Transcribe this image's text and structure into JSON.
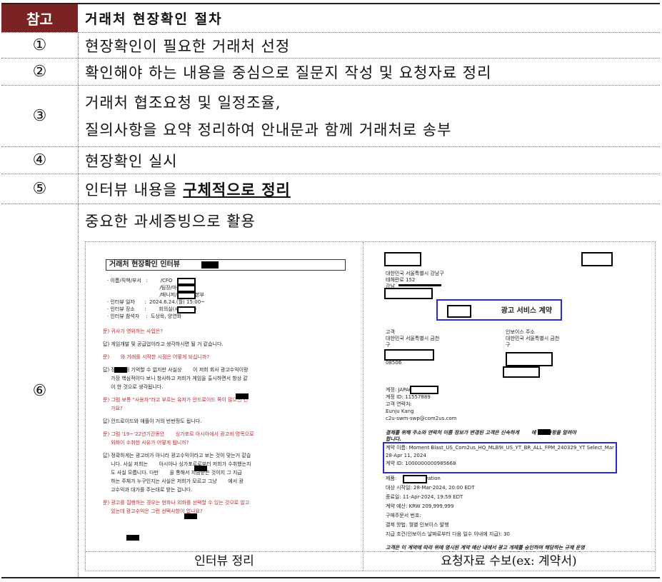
{
  "header": {
    "badge": "참고",
    "title": "거래처 현장확인 절차"
  },
  "steps": [
    {
      "num": "①",
      "text": "현장확인이 필요한 거래처 선정"
    },
    {
      "num": "②",
      "text": "확인해야 하는 내용을 중심으로 질문지 작성 및 요청자료 정리"
    },
    {
      "num": "③",
      "line1": "거래처 협조요청 및 일정조율,",
      "line2": "질의사항을 요약 정리하여 안내문과 함께 거래처로 송부"
    },
    {
      "num": "④",
      "text": "현장확인 실시"
    },
    {
      "num": "⑤",
      "text_prefix": "인터뷰 내용을 ",
      "emphasis": "구체적으로 정리"
    },
    {
      "num": "⑥",
      "text": "중요한 과세증빙으로 활용"
    }
  ],
  "captions": {
    "left": "인터뷰 정리",
    "right": "요청자료 수보(ex: 계약서)"
  },
  "interview": {
    "title": "거래처 현장확인 인터뷰",
    "fields": [
      "· 이름/직책/부서   :        /CFO",
      "                                 /팀장/마케팅본부",
      "                                 /매니저/경영지원본부",
      "· 인터뷰 일자      :  2024.6.24.(월) 15:00~",
      "· 인터뷰 장소      :        회의실(서울 강남)",
      "· 인터뷰 참석자    :  도상욱, 양연화"
    ],
    "qa": [
      {
        "t": "q",
        "lines": [
          "문) 귀사가 영위하는 사업은?"
        ]
      },
      {
        "t": "a",
        "lines": [
          "답) 게임개발 및 공급업이라고 생각하시면 될 거 같습니다."
        ]
      },
      {
        "t": "q",
        "lines": [
          "문)       와 거래를 시작한 시점은 어떻게 되십니까?"
        ]
      },
      {
        "t": "a",
        "lines": [
          "답) 정확하게 기억할 수 없지만 사실상       이 저희 회사 광고수익이랑",
          "     가장 핵심적이다 보니 창사하고 저희가 게임을 출시하면서 항상 같",
          "     이 한 것으로 생각됩니다."
        ]
      },
      {
        "t": "q",
        "lines": [
          "문) 그럼 보통 \"사용자\"라고 부르는 유저가 안드로이드 쪽이 많으신 건",
          "     가요?"
        ]
      },
      {
        "t": "a",
        "lines": [
          "답) 안드로이드와 애플이 거의 반반정도 됩니다."
        ]
      },
      {
        "t": "q",
        "lines": [
          "문) 그럼 '19~'22년기간동안       싱가포르 아시아에서 광고비 명목으로",
          "     외화이 수취한 사유가 어떻게 됩니까?"
        ]
      },
      {
        "t": "a",
        "lines": [
          "답) 정확하게는 광고비가 아니라 광고수익이라고 보는 것이 맞는거 같습",
          "     니다. 사실 저희는       아시아나 싱가포르로부터 저희가 수취했는지",
          "     도 사실 모릅니다. 다만       을 통해서 지금받은 것이지 그 지급",
          "     하는 주체가 누구인지는 사실은 저희가 모르고 그냥       에서 광",
          "     고수익과 대가를 주는대로 받는 겁니다."
        ]
      },
      {
        "t": "q",
        "lines": [
          "문) 광고를 집행하는 경우는 현화나 외화를 선택할 수 있는 것으로 알고",
          "     있는데 광고수익은 그런 선택사항이 없나요?"
        ]
      }
    ]
  },
  "contract": {
    "address1": [
      "대한민국 서울특별시 강남구",
      "테헤란로 152",
      "강남"
    ],
    "title": "광고 서비스 계약",
    "client_label": "고객",
    "client_addr": [
      "대한민국 서울특별시 금천",
      "구"
    ],
    "client_zip": "08506",
    "invoice_label": "인보이스 주소",
    "invoice_addr": [
      "대한민국 서울특별시 금천",
      "구"
    ],
    "account_lines": [
      "계정: JAPAC_KR",
      "계정 ID: 11557889",
      "고객 연락처:",
      "Eunju Kang",
      "c2u-swm-swp@com2us.com"
    ],
    "notice": [
      "결제를 위해 주소와 연락처 이름 정보가 변경된 고객은 신속하게       에 변경사항을 알려야",
      "합니다."
    ],
    "campaign": [
      "계약 이름: Moment Blast_US_Com2us_HQ_MLB9I_US_YT_BR_ALL_FPM_240329_YT Select_Mar",
      "28-Apr 11, 2024",
      "계약 ID: 1000000000985668"
    ],
    "details": [
      "제품:         Reservation",
      "대상 시작일: 28-Mar-2024, 20:00 EDT",
      "종료일: 11-Apr-2024, 19:59 EDT",
      "계약 예산: KRW 209,999,999",
      "구매주문서 번호:",
      "결제 방법: 월별 인보이스 발행",
      "지급 조건(인보이스 날짜로부터 다음 일수 이내에 지급): 30"
    ],
    "footer": [
      "고객은 이 계약에 따라 위에 명시된 계약 예산 내에서 광고 게재를 승인하며 해당하는 규제 운영",
      "비용, 국가별 수수료 또는 부가금, 기타 유사 수수료 또는 비용을 제외한 계약 예산을 초과하는",
      "금액이 청구되지 않습니다."
    ]
  }
}
